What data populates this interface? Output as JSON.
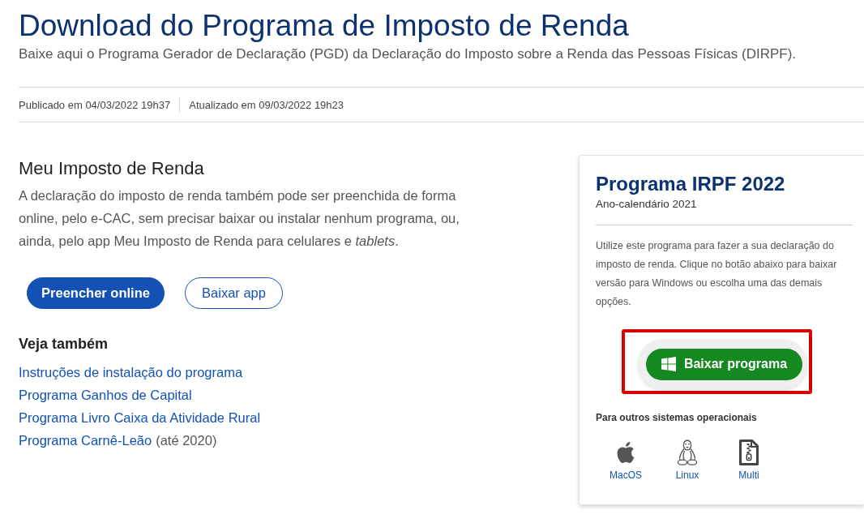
{
  "header": {
    "title": "Download do Programa de Imposto de Renda",
    "subtitle": "Baixe aqui o Programa Gerador de Declaração (PGD) da Declaração do Imposto sobre a Renda das Pessoas Físicas (DIRPF).",
    "published": "Publicado em 04/03/2022 19h37",
    "updated": "Atualizado em 09/03/2022 19h23"
  },
  "meu_imposto": {
    "heading": "Meu Imposto de Renda",
    "text": "A declaração do imposto de renda também pode ser preenchida de forma online, pelo e-CAC, sem precisar baixar ou instalar nenhum programa, ou, ainda, pelo app Meu Imposto de Renda para celulares e *tablets*.",
    "buttons": [
      {
        "label": "Preencher online",
        "kind": "primary"
      },
      {
        "label": "Baixar app",
        "kind": "secondary"
      }
    ]
  },
  "see_also": {
    "heading": "Veja também",
    "links": [
      {
        "label": "Instruções de instalação do programa"
      },
      {
        "label": "Programa Ganhos de Capital"
      },
      {
        "label": "Programa Livro Caixa da Atividade Rural"
      },
      {
        "label": "Programa Carnê-Leão",
        "note": "(até 2020)"
      }
    ]
  },
  "download_card": {
    "title": "Programa IRPF 2022",
    "subtitle": "Ano-calendário 2021",
    "text": "Utilize este programa para fazer a sua declaração do imposto de renda. Clique no botão abaixo para baixar versão para Windows ou escolha uma das demais opções.",
    "main_button": "Baixar programa",
    "other_heading": "Para outros sistemas operacionais",
    "other_systems": [
      {
        "label": "MacOS",
        "kind": "apple"
      },
      {
        "label": "Linux",
        "kind": "penguin"
      },
      {
        "label": "Multi",
        "kind": "zip"
      }
    ]
  }
}
